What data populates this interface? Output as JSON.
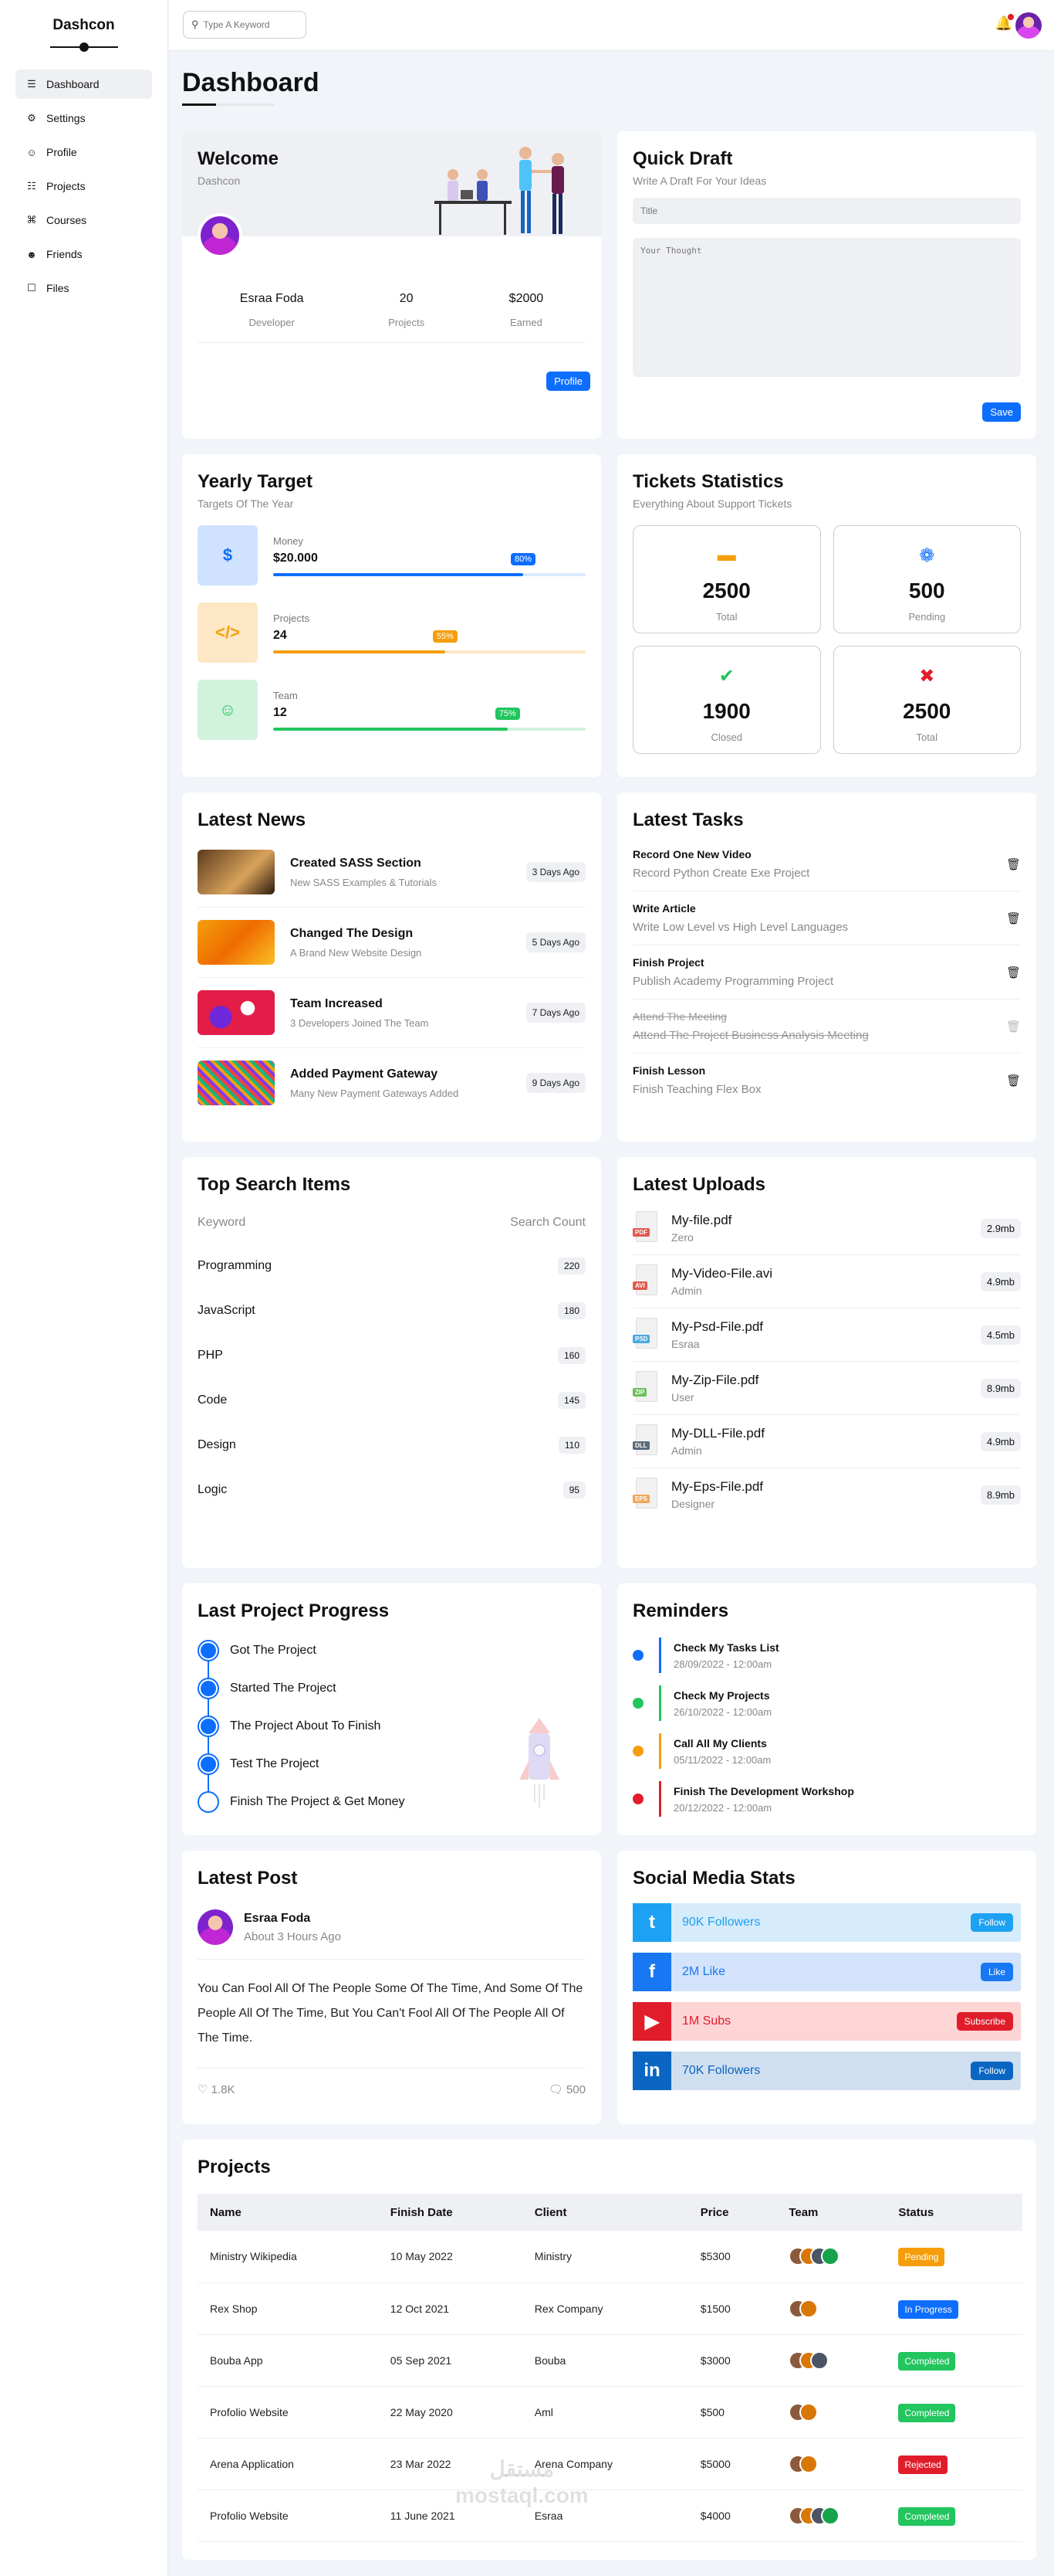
{
  "sidebar": {
    "logo": "Dashcon",
    "items": [
      {
        "label": "Dashboard",
        "icon": "chart-icon"
      },
      {
        "label": "Settings",
        "icon": "gear-icon"
      },
      {
        "label": "Profile",
        "icon": "user-icon"
      },
      {
        "label": "Projects",
        "icon": "diagram-icon"
      },
      {
        "label": "Courses",
        "icon": "graduation-cap-icon"
      },
      {
        "label": "Friends",
        "icon": "friends-icon"
      },
      {
        "label": "Files",
        "icon": "file-icon"
      }
    ]
  },
  "header": {
    "search_placeholder": "Type A Keyword"
  },
  "page_title": "Dashboard",
  "welcome": {
    "title": "Welcome",
    "subtitle": "Dashcon",
    "name": "Esraa Foda",
    "role": "Developer",
    "projects_value": "20",
    "projects_label": "Projects",
    "earned_value": "$2000",
    "earned_label": "Earned",
    "profile_button": "Profile"
  },
  "draft": {
    "title": "Quick Draft",
    "subtitle": "Write A Draft For Your Ideas",
    "title_placeholder": "Title",
    "body_placeholder": "Your Thought",
    "save_button": "Save"
  },
  "target": {
    "title": "Yearly Target",
    "subtitle": "Targets Of The Year",
    "items": [
      {
        "label": "Money",
        "value": "$20.000",
        "percent": "80%",
        "fill": 80,
        "color": "#0d6efd",
        "track": "#dbeafe",
        "bg": "#cfe2ff",
        "icon": "$"
      },
      {
        "label": "Projects",
        "value": "24",
        "percent": "55%",
        "fill": 55,
        "color": "#f59e0b",
        "track": "#fde7c5",
        "bg": "#fde7c5",
        "icon": "</>"
      },
      {
        "label": "Team",
        "value": "12",
        "percent": "75%",
        "fill": 75,
        "color": "#22c55e",
        "track": "#d1f2dd",
        "bg": "#d1f2dd",
        "icon": "☺"
      }
    ]
  },
  "tickets": {
    "title": "Tickets Statistics",
    "subtitle": "Everything About Support Tickets",
    "items": [
      {
        "value": "2500",
        "label": "Total",
        "icon": "ticket-icon",
        "color": "#f59e0b"
      },
      {
        "value": "500",
        "label": "Pending",
        "icon": "spinner-icon",
        "color": "#0d6efd"
      },
      {
        "value": "1900",
        "label": "Closed",
        "icon": "check-circle-icon",
        "color": "#22c55e"
      },
      {
        "value": "2500",
        "label": "Total",
        "icon": "x-square-icon",
        "color": "#e11d2b"
      }
    ]
  },
  "news": {
    "title": "Latest News",
    "items": [
      {
        "title": "Created SASS Section",
        "sub": "New SASS Examples & Tutorials",
        "date": "3 Days Ago"
      },
      {
        "title": "Changed The Design",
        "sub": "A Brand New Website Design",
        "date": "5 Days Ago"
      },
      {
        "title": "Team Increased",
        "sub": "3 Developers Joined The Team",
        "date": "7 Days Ago"
      },
      {
        "title": "Added Payment Gateway",
        "sub": "Many New Payment Gateways Added",
        "date": "9 Days Ago"
      }
    ]
  },
  "tasks": {
    "title": "Latest Tasks",
    "items": [
      {
        "title": "Record One New Video",
        "sub": "Record Python Create Exe Project",
        "done": false
      },
      {
        "title": "Write Article",
        "sub": "Write Low Level vs High Level Languages",
        "done": false
      },
      {
        "title": "Finish Project",
        "sub": "Publish Academy Programming Project",
        "done": false
      },
      {
        "title": "Attend The Meeting",
        "sub": "Attend The Project Business Analysis Meeting",
        "done": true
      },
      {
        "title": "Finish Lesson",
        "sub": "Finish Teaching Flex Box",
        "done": false
      }
    ]
  },
  "search_items": {
    "title": "Top Search Items",
    "col_keyword": "Keyword",
    "col_count": "Search Count",
    "rows": [
      {
        "keyword": "Programming",
        "count": "220"
      },
      {
        "keyword": "JavaScript",
        "count": "180"
      },
      {
        "keyword": "PHP",
        "count": "160"
      },
      {
        "keyword": "Code",
        "count": "145"
      },
      {
        "keyword": "Design",
        "count": "110"
      },
      {
        "keyword": "Logic",
        "count": "95"
      }
    ]
  },
  "uploads": {
    "title": "Latest Uploads",
    "items": [
      {
        "name": "My-file.pdf",
        "by": "Zero",
        "size": "2.9mb",
        "tag": "PDF",
        "color": "#e05a4e"
      },
      {
        "name": "My-Video-File.avi",
        "by": "Admin",
        "size": "4.9mb",
        "tag": "AVI",
        "color": "#e05a4e"
      },
      {
        "name": "My-Psd-File.pdf",
        "by": "Esraa",
        "size": "4.5mb",
        "tag": "PSD",
        "color": "#4aa8e0"
      },
      {
        "name": "My-Zip-File.pdf",
        "by": "User",
        "size": "8.9mb",
        "tag": "ZIP",
        "color": "#6cbf5b"
      },
      {
        "name": "My-DLL-File.pdf",
        "by": "Admin",
        "size": "4.9mb",
        "tag": "DLL",
        "color": "#5b6b7b"
      },
      {
        "name": "My-Eps-File.pdf",
        "by": "Designer",
        "size": "8.9mb",
        "tag": "EPS",
        "color": "#f2a65a"
      }
    ]
  },
  "progress": {
    "title": "Last Project Progress",
    "items": [
      {
        "label": "Got The Project",
        "done": true
      },
      {
        "label": "Started The Project",
        "done": true
      },
      {
        "label": "The Project About To Finish",
        "done": true
      },
      {
        "label": "Test The Project",
        "done": true
      },
      {
        "label": "Finish The Project & Get Money",
        "done": false
      }
    ]
  },
  "reminders": {
    "title": "Reminders",
    "items": [
      {
        "title": "Check My Tasks List",
        "date": "28/09/2022 - 12:00am",
        "color": "#0d6efd"
      },
      {
        "title": "Check My Projects",
        "date": "26/10/2022 - 12:00am",
        "color": "#22c55e"
      },
      {
        "title": "Call All My Clients",
        "date": "05/11/2022 - 12:00am",
        "color": "#f59e0b"
      },
      {
        "title": "Finish The Development Workshop",
        "date": "20/12/2022 - 12:00am",
        "color": "#e11d2b"
      }
    ]
  },
  "post": {
    "title": "Latest Post",
    "author": "Esraa Foda",
    "time": "About 3 Hours Ago",
    "body": "You Can Fool All Of The People Some Of The Time, And Some Of The People All Of The Time, But You Can't Fool All Of The People All Of The Time.",
    "likes": "1.8K",
    "comments": "500"
  },
  "social": {
    "title": "Social Media Stats",
    "items": [
      {
        "logo": "t",
        "icon": "twitter-icon",
        "text": "90K Followers",
        "button": "Follow",
        "color": "#1da1f2",
        "bg": "#d6ecfb"
      },
      {
        "logo": "f",
        "icon": "facebook-icon",
        "text": "2M Like",
        "button": "Like",
        "color": "#1877f2",
        "bg": "#d3e3fb"
      },
      {
        "logo": "▶",
        "icon": "youtube-icon",
        "text": "1M Subs",
        "button": "Subscribe",
        "color": "#e11d2b",
        "bg": "#fdd5d5"
      },
      {
        "logo": "in",
        "icon": "linkedin-icon",
        "text": "70K Followers",
        "button": "Follow",
        "color": "#0a66c2",
        "bg": "#d0dff0"
      }
    ]
  },
  "projects": {
    "title": "Projects",
    "columns": [
      "Name",
      "Finish Date",
      "Client",
      "Price",
      "Team",
      "Status"
    ],
    "rows": [
      {
        "name": "Ministry Wikipedia",
        "date": "10 May 2022",
        "client": "Ministry",
        "price": "$5300",
        "team": 4,
        "status": "Pending",
        "color": "#f59e0b"
      },
      {
        "name": "Rex Shop",
        "date": "12 Oct 2021",
        "client": "Rex Company",
        "price": "$1500",
        "team": 2,
        "status": "In Progress",
        "color": "#0d6efd"
      },
      {
        "name": "Bouba App",
        "date": "05 Sep 2021",
        "client": "Bouba",
        "price": "$3000",
        "team": 3,
        "status": "Completed",
        "color": "#22c55e"
      },
      {
        "name": "Profolio Website",
        "date": "22 May 2020",
        "client": "Aml",
        "price": "$500",
        "team": 2,
        "status": "Completed",
        "color": "#22c55e"
      },
      {
        "name": "Arena Application",
        "date": "23 Mar 2022",
        "client": "Arena Company",
        "price": "$5000",
        "team": 2,
        "status": "Rejected",
        "color": "#e11d2b"
      },
      {
        "name": "Profolio Website",
        "date": "11 June 2021",
        "client": "Esraa",
        "price": "$4000",
        "team": 4,
        "status": "Completed",
        "color": "#22c55e"
      }
    ]
  },
  "watermark": "مستقل\nmostaql.com"
}
